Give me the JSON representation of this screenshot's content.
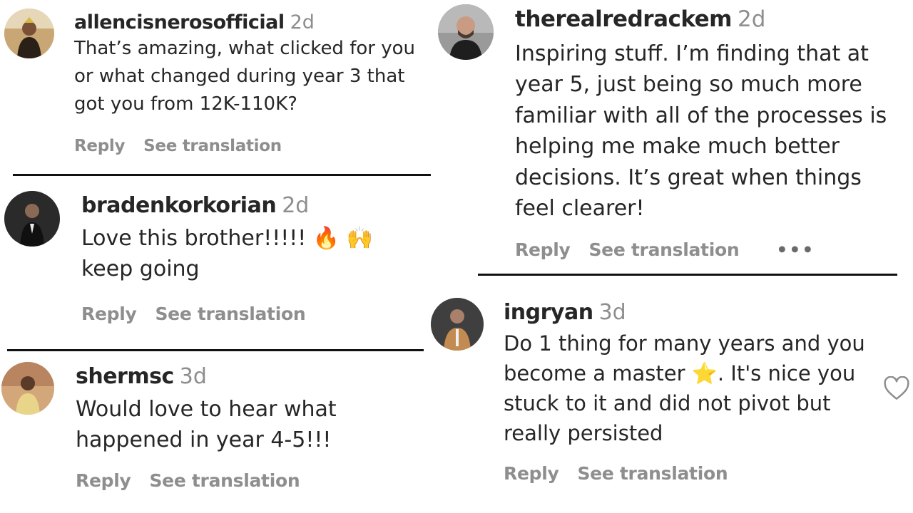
{
  "comments": [
    {
      "username": "allencisnerosofficial",
      "time": "2d",
      "text": "That’s amazing, what clicked for you or what changed during year 3 that got you from 12K-110K?",
      "reply": "Reply",
      "translate": "See translation"
    },
    {
      "username": "bradenkorkorian",
      "time": "2d",
      "text_before": "Love this brother!!!!! ",
      "emoji_1": "🔥",
      "emoji_2": "🙌",
      "text_after": " keep going",
      "reply": "Reply",
      "translate": "See translation"
    },
    {
      "username": "shermsc",
      "time": "3d",
      "text": "Would love to hear what happened in year 4-5!!!",
      "reply": "Reply",
      "translate": "See translation"
    },
    {
      "username": "therealredrackem",
      "time": "2d",
      "text": "Inspiring stuff. I’m finding that at year 5, just being so much more familiar with all of the processes is helping me make much better decisions. It’s great when things feel clearer!",
      "reply": "Reply",
      "translate": "See translation",
      "more": "•••"
    },
    {
      "username": "ingryan",
      "time": "3d",
      "text_before": "Do 1 thing for many years and you become a master ",
      "emoji_1": "⭐",
      "text_after": ". It's nice you stuck to it and did not pivot but really persisted",
      "reply": "Reply",
      "translate": "See translation"
    }
  ],
  "icons": {
    "more": "more-options-icon",
    "like": "heart-icon"
  },
  "colors": {
    "username": "#262626",
    "muted": "#8e8e8e",
    "divider": "#111111",
    "background": "#ffffff"
  }
}
